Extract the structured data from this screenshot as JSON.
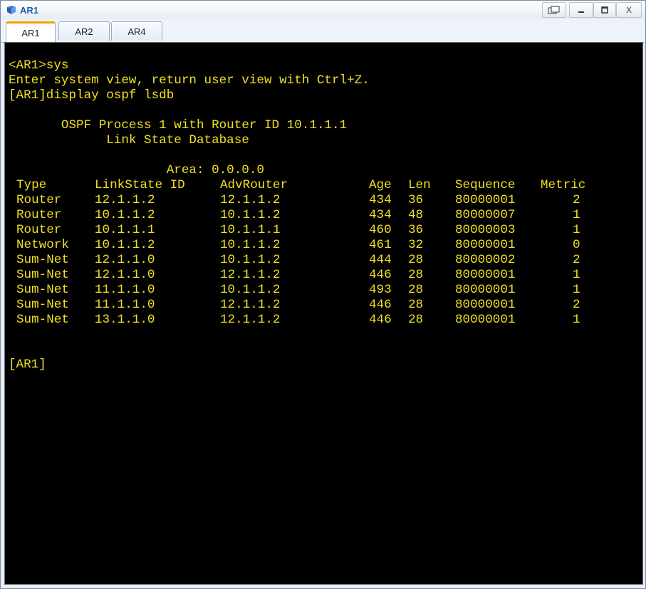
{
  "window": {
    "title": "AR1",
    "icon": "router-console-icon",
    "controls": [
      "restore-icon",
      "minimize-icon",
      "maximize-icon",
      "close-icon"
    ],
    "close_label": "X"
  },
  "tabs": [
    {
      "label": "AR1",
      "active": true
    },
    {
      "label": "AR2",
      "active": false
    },
    {
      "label": "AR4",
      "active": false
    }
  ],
  "terminal": {
    "text_color": "#f0e020",
    "background": "#000000",
    "lines": [
      "<AR1>sys",
      "Enter system view, return user view with Ctrl+Z.",
      "[AR1]display ospf lsdb",
      "",
      "       OSPF Process 1 with Router ID 10.1.1.1",
      "             Link State Database",
      "",
      "                     Area: 0.0.0.0"
    ],
    "table": {
      "headers": [
        "Type",
        "LinkState ID",
        "AdvRouter",
        "Age",
        "Len",
        "Sequence",
        "Metric"
      ],
      "rows": [
        [
          "Router",
          "12.1.1.2",
          "12.1.1.2",
          "434",
          "36",
          "80000001",
          "2"
        ],
        [
          "Router",
          "10.1.1.2",
          "10.1.1.2",
          "434",
          "48",
          "80000007",
          "1"
        ],
        [
          "Router",
          "10.1.1.1",
          "10.1.1.1",
          "460",
          "36",
          "80000003",
          "1"
        ],
        [
          "Network",
          "10.1.1.2",
          "10.1.1.2",
          "461",
          "32",
          "80000001",
          "0"
        ],
        [
          "Sum-Net",
          "12.1.1.0",
          "10.1.1.2",
          "444",
          "28",
          "80000002",
          "2"
        ],
        [
          "Sum-Net",
          "12.1.1.0",
          "12.1.1.2",
          "446",
          "28",
          "80000001",
          "1"
        ],
        [
          "Sum-Net",
          "11.1.1.0",
          "10.1.1.2",
          "493",
          "28",
          "80000001",
          "1"
        ],
        [
          "Sum-Net",
          "11.1.1.0",
          "12.1.1.2",
          "446",
          "28",
          "80000001",
          "2"
        ],
        [
          "Sum-Net",
          "13.1.1.0",
          "12.1.1.2",
          "446",
          "28",
          "80000001",
          "1"
        ]
      ]
    },
    "final_prompt": "[AR1]"
  }
}
